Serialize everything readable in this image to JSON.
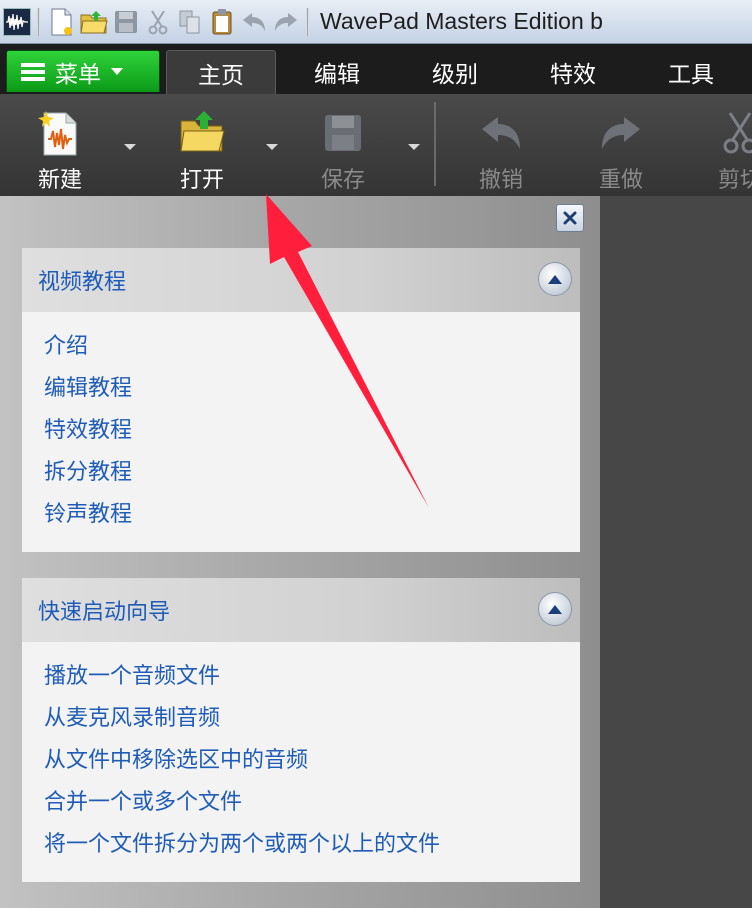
{
  "window": {
    "title": "WavePad Masters Edition b"
  },
  "quick_access": {
    "icons": [
      "waveform-app-icon",
      "new-file-icon",
      "open-folder-icon",
      "save-icon",
      "cut-icon",
      "copy-icon",
      "paste-icon",
      "undo-icon",
      "redo-icon"
    ]
  },
  "tabs": {
    "menu_label": "菜单",
    "items": [
      "主页",
      "编辑",
      "级别",
      "特效",
      "工具"
    ],
    "active": "主页"
  },
  "ribbon": {
    "new_label": "新建",
    "open_label": "打开",
    "save_label": "保存",
    "undo_label": "撤销",
    "redo_label": "重做",
    "cut_label": "剪切"
  },
  "panel": {
    "video_tutorials": {
      "title": "视频教程",
      "items": [
        "介绍",
        "编辑教程",
        "特效教程",
        "拆分教程",
        "铃声教程"
      ]
    },
    "quick_start": {
      "title": "快速启动向导",
      "items": [
        "播放一个音频文件",
        "从麦克风录制音频",
        "从文件中移除选区中的音频",
        "合并一个或多个文件",
        "将一个文件拆分为两个或两个以上的文件"
      ]
    }
  },
  "colors": {
    "menu_green": "#14b524",
    "link_blue": "#1f5cb8",
    "annotation_red": "#ff1f3d"
  }
}
